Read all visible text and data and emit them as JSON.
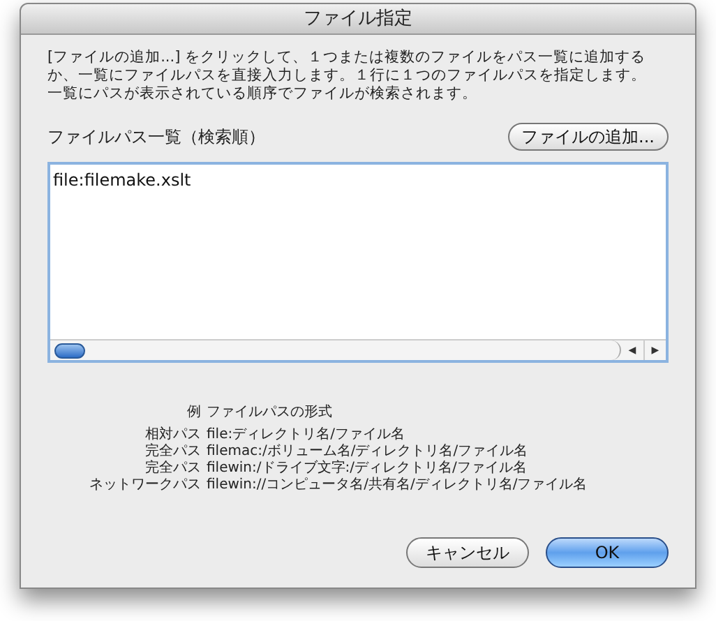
{
  "window": {
    "title": "ファイル指定"
  },
  "description": "[ファイルの追加...] をクリックして、１つまたは複数のファイルをパス一覧に追加するか、一覧にファイルパスを直接入力します。１行に１つのファイルパスを指定します。一覧にパスが表示されている順序でファイルが検索されます。",
  "list_label": "ファイルパス一覧（検索順）",
  "add_button": "ファイルの追加...",
  "path_list": {
    "value": "file:filemake.xslt",
    "scroll_left": "◀",
    "scroll_right": "▶"
  },
  "examples": {
    "label": "例",
    "heading": "ファイルパスの形式",
    "rows": [
      {
        "label": "相対パス",
        "value": "file:ディレクトリ名/ファイル名"
      },
      {
        "label": "完全パス",
        "value": "filemac:/ボリューム名/ディレクトリ名/ファイル名"
      },
      {
        "label": "完全パス",
        "value": "filewin:/ドライブ文字:/ディレクトリ名/ファイル名"
      },
      {
        "label": "ネットワークパス",
        "value": "filewin://コンピュータ名/共有名/ディレクトリ名/ファイル名"
      }
    ]
  },
  "buttons": [
    {
      "label": "キャンセル",
      "default": false
    },
    {
      "label": "OK",
      "default": true
    }
  ]
}
